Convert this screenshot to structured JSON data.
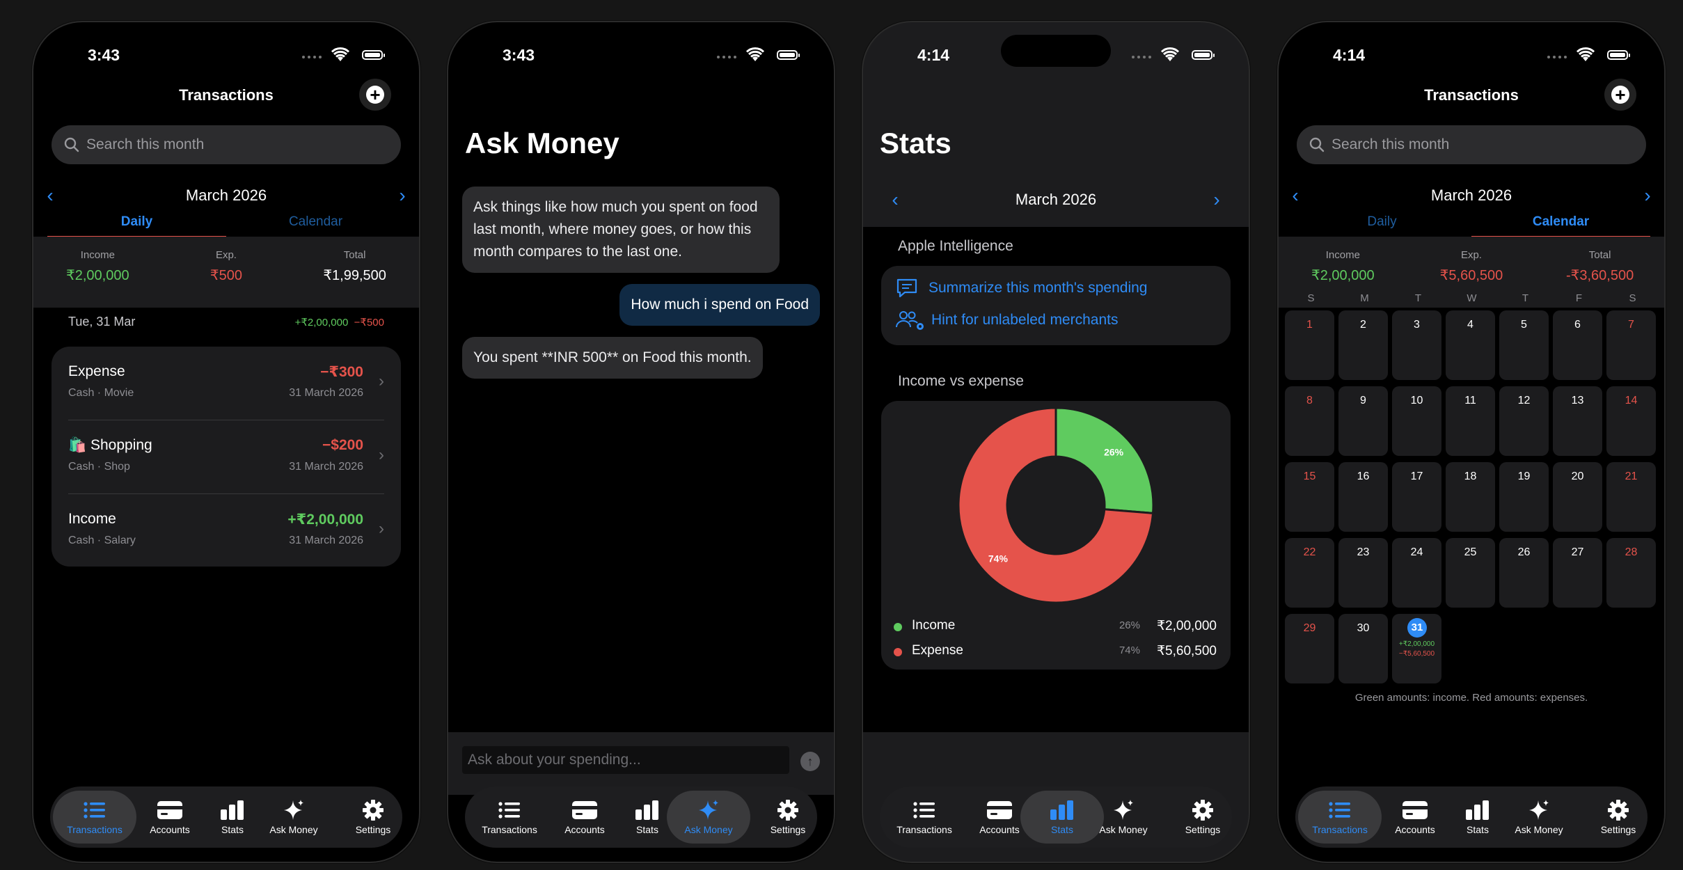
{
  "colors": {
    "accent": "#2f8cf6",
    "income": "#5fcb5f",
    "expense": "#e5534b",
    "background": "#000000",
    "card": "#1c1c1e"
  },
  "tab_bar": {
    "items": [
      {
        "label": "Transactions",
        "icon": "list-icon"
      },
      {
        "label": "Accounts",
        "icon": "card-icon"
      },
      {
        "label": "Stats",
        "icon": "chart-bar-icon"
      },
      {
        "label": "Ask Money",
        "icon": "sparkle-icon"
      },
      {
        "label": "Settings",
        "icon": "gear-icon"
      }
    ]
  },
  "screen1": {
    "time": "3:43",
    "title": "Transactions",
    "search_placeholder": "Search this month",
    "month": "March 2026",
    "tabs": [
      "Daily",
      "Calendar"
    ],
    "active_tab": "Daily",
    "summary": {
      "income_label": "Income",
      "income": "₹2,00,000",
      "exp_label": "Exp.",
      "exp": "₹500",
      "total_label": "Total",
      "total": "₹1,99,500"
    },
    "day": {
      "label": "Tue, 31 Mar",
      "income": "+₹2,00,000",
      "expense": "−₹500"
    },
    "transactions": [
      {
        "name": "Expense",
        "sub": "Cash · Movie",
        "amount": "−₹300",
        "date": "31 March 2026",
        "kind": "expense"
      },
      {
        "name": "🛍️ Shopping",
        "sub": "Cash · Shop",
        "amount": "−$200",
        "date": "31 March 2026",
        "kind": "expense"
      },
      {
        "name": "Income",
        "sub": "Cash · Salary",
        "amount": "+₹2,00,000",
        "date": "31 March 2026",
        "kind": "income"
      }
    ],
    "active_nav": "Transactions"
  },
  "screen2": {
    "time": "3:43",
    "title": "Ask Money",
    "messages": [
      {
        "role": "assistant",
        "text": "Ask things like how much you spent on food last month, where money goes, or how this month compares to the last one."
      },
      {
        "role": "user",
        "text": "How much i spend on Food"
      },
      {
        "role": "assistant",
        "text": "You spent **INR 500** on Food this month."
      }
    ],
    "input_placeholder": "Ask about your spending...",
    "active_nav": "Ask Money"
  },
  "screen3": {
    "time": "4:14",
    "title": "Stats",
    "month": "March 2026",
    "ai_section": "Apple Intelligence",
    "ai_actions": [
      {
        "label": "Summarize this month's spending",
        "icon": "chat-bubble-icon"
      },
      {
        "label": "Hint for unlabeled merchants",
        "icon": "people-gear-icon"
      }
    ],
    "chart_section": "Income vs expense",
    "legend": [
      {
        "name": "Income",
        "percent": "26%",
        "amount": "₹2,00,000"
      },
      {
        "name": "Expense",
        "percent": "74%",
        "amount": "₹5,60,500"
      }
    ],
    "active_nav": "Stats"
  },
  "chart_data": {
    "type": "pie",
    "title": "Income vs expense",
    "categories": [
      "Income",
      "Expense"
    ],
    "values": [
      200000,
      560500
    ],
    "labels": [
      "26%",
      "74%"
    ],
    "colors": [
      "#5fcb5f",
      "#e5534b"
    ],
    "donut": true
  },
  "screen4": {
    "time": "4:14",
    "title": "Transactions",
    "search_placeholder": "Search this month",
    "month": "March 2026",
    "tabs": [
      "Daily",
      "Calendar"
    ],
    "active_tab": "Calendar",
    "summary": {
      "income_label": "Income",
      "income": "₹2,00,000",
      "exp_label": "Exp.",
      "exp": "₹5,60,500",
      "total_label": "Total",
      "total": "-₹3,60,500"
    },
    "weekdays": [
      "S",
      "M",
      "T",
      "W",
      "T",
      "F",
      "S"
    ],
    "today": "31",
    "today_income": "+₹2,00,000",
    "today_expense": "−₹5,60,500",
    "note": "Green amounts: income. Red amounts: expenses.",
    "active_nav": "Transactions"
  }
}
